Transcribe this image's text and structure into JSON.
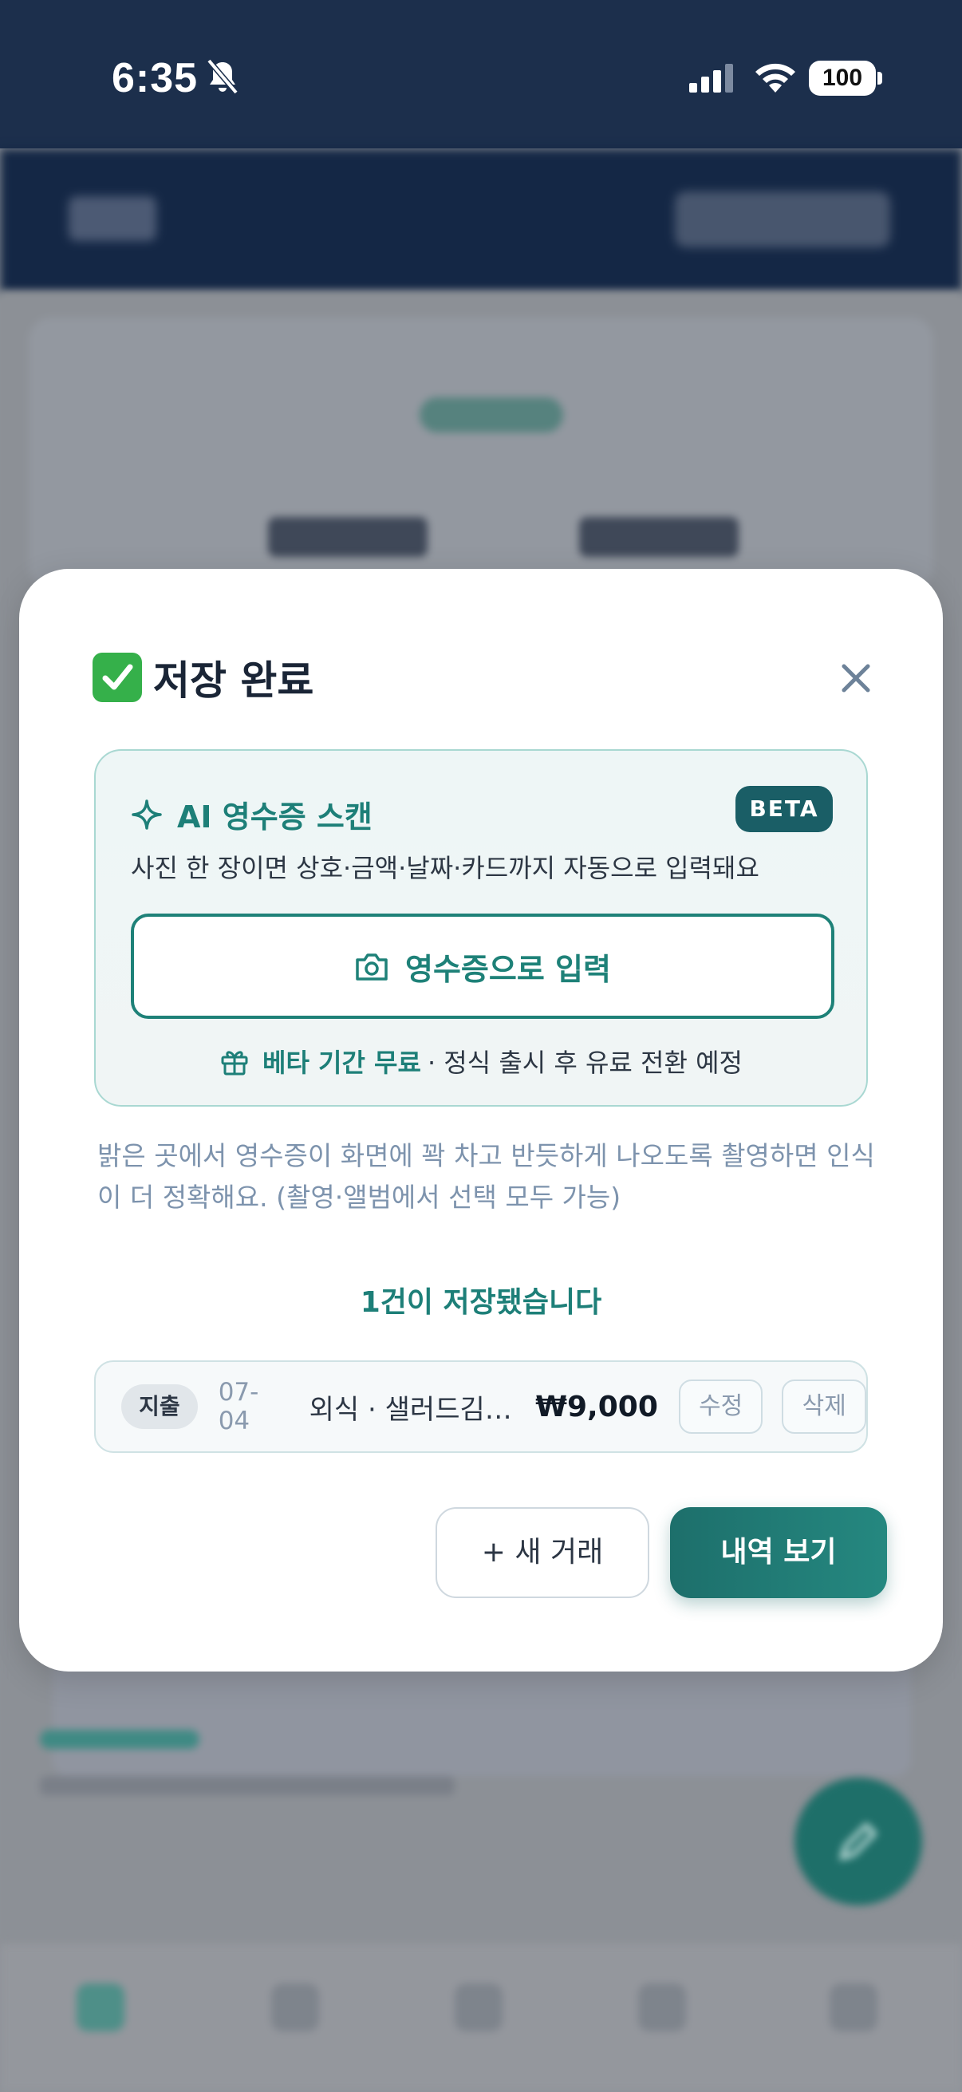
{
  "status_bar": {
    "time": "6:35",
    "battery": "100",
    "icons": [
      "bell-slash-icon",
      "cellular-signal-icon",
      "wifi-icon",
      "battery-icon"
    ]
  },
  "modal": {
    "title": "저장 완료",
    "title_icon": "check-mark-icon",
    "close_icon": "close-icon",
    "scan_card": {
      "title": "AI 영수증 스캔",
      "badge": "BETA",
      "description": "사진 한 장이면 상호·금액·날짜·카드까지 자동으로 입력돼요",
      "button_label": "영수증으로 입력",
      "promo_strong": "베타 기간 무료",
      "promo_rest": "· 정식 출시 후 유료 전환 예정"
    },
    "tip": "밝은 곳에서 영수증이 화면에 꽉 차고 반듯하게 나오도록 촬영하면 인식이 더 정확해요. (촬영·앨범에서 선택 모두 가능)",
    "saved_message": "1건이 저장됐습니다",
    "transactions": [
      {
        "type": "지출",
        "date": "07-04",
        "description": "외식 · 샐러드김…",
        "amount": "₩9,000",
        "edit_label": "수정",
        "delete_label": "삭제"
      }
    ],
    "actions": {
      "new_label": "+ 새 거래",
      "view_label": "내역 보기"
    }
  },
  "colors": {
    "accent": "#1d7f78",
    "status_bar_bg": "#1c2f4c",
    "badge_bg": "#1a5e66"
  }
}
